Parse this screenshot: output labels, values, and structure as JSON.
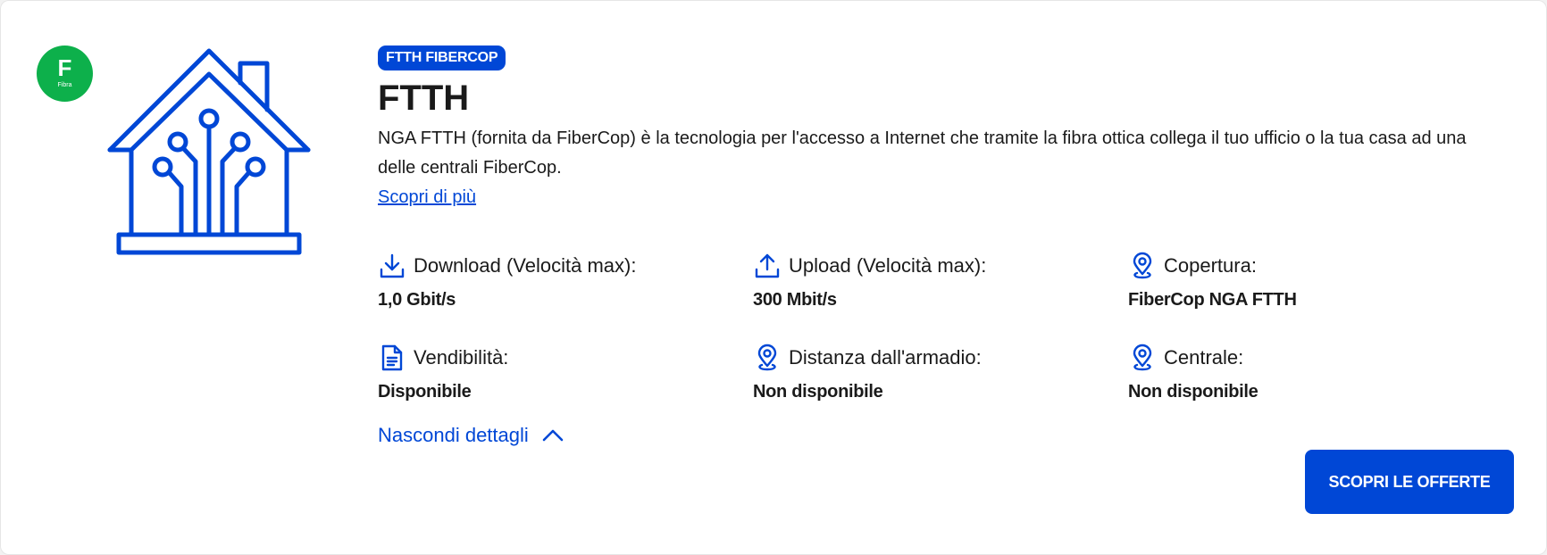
{
  "badge": {
    "letter": "F",
    "sub": "Fibra",
    "color": "#0db04b"
  },
  "chip": {
    "label": "FTTH FIBERCOP"
  },
  "title": "FTTH",
  "description": "NGA FTTH (fornita da FiberCop) è la tecnologia per l'accesso a Internet che tramite la fibra ottica collega il tuo ufficio o la tua casa ad una delle centrali FiberCop.",
  "more_link": "Scopri di più",
  "specs": [
    {
      "icon": "download-icon",
      "label": "Download (Velocità max):",
      "value": "1,0 Gbit/s"
    },
    {
      "icon": "upload-icon",
      "label": "Upload (Velocità max):",
      "value": "300 Mbit/s"
    },
    {
      "icon": "location-pin-icon",
      "label": "Copertura:",
      "value": "FiberCop NGA FTTH"
    },
    {
      "icon": "document-icon",
      "label": "Vendibilità:",
      "value": "Disponibile"
    },
    {
      "icon": "location-pin-icon",
      "label": "Distanza dall'armadio:",
      "value": "Non disponibile"
    },
    {
      "icon": "location-pin-icon",
      "label": "Centrale:",
      "value": "Non disponibile"
    }
  ],
  "toggle_details": "Nascondi dettagli",
  "cta": "SCOPRI LE OFFERTE",
  "colors": {
    "brand_blue": "#0047d6",
    "badge_green": "#0db04b"
  }
}
